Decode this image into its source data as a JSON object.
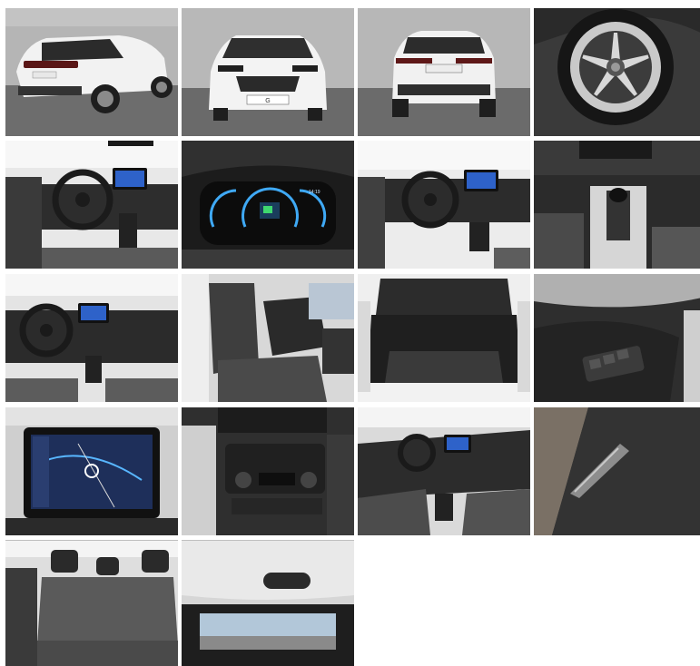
{
  "gallery": {
    "photos": [
      {
        "subject": "exterior-rear-three-quarter",
        "plate_text": ""
      },
      {
        "subject": "exterior-front",
        "plate_text": "G"
      },
      {
        "subject": "exterior-rear",
        "plate_text": ""
      },
      {
        "subject": "alloy-wheel"
      },
      {
        "subject": "dashboard-driver-side"
      },
      {
        "subject": "instrument-cluster",
        "display_text": "14:19"
      },
      {
        "subject": "dashboard-wide"
      },
      {
        "subject": "gear-shifter"
      },
      {
        "subject": "dashboard-steering-wheel"
      },
      {
        "subject": "front-seats"
      },
      {
        "subject": "trunk"
      },
      {
        "subject": "door-window-switches"
      },
      {
        "subject": "touchscreen-navigation"
      },
      {
        "subject": "climate-controls"
      },
      {
        "subject": "dashboard-passenger-view"
      },
      {
        "subject": "door-handle-detail"
      },
      {
        "subject": "rear-seats"
      },
      {
        "subject": "tailgate-interior"
      }
    ]
  },
  "colors": {
    "background": "#ffffff",
    "showroom_wall": "#b5b5b5",
    "showroom_floor": "#6d6d6d",
    "car_white": "#f2f2f2",
    "interior_dark": "#2a2a2a",
    "screen_blue": "#2e62c9"
  }
}
